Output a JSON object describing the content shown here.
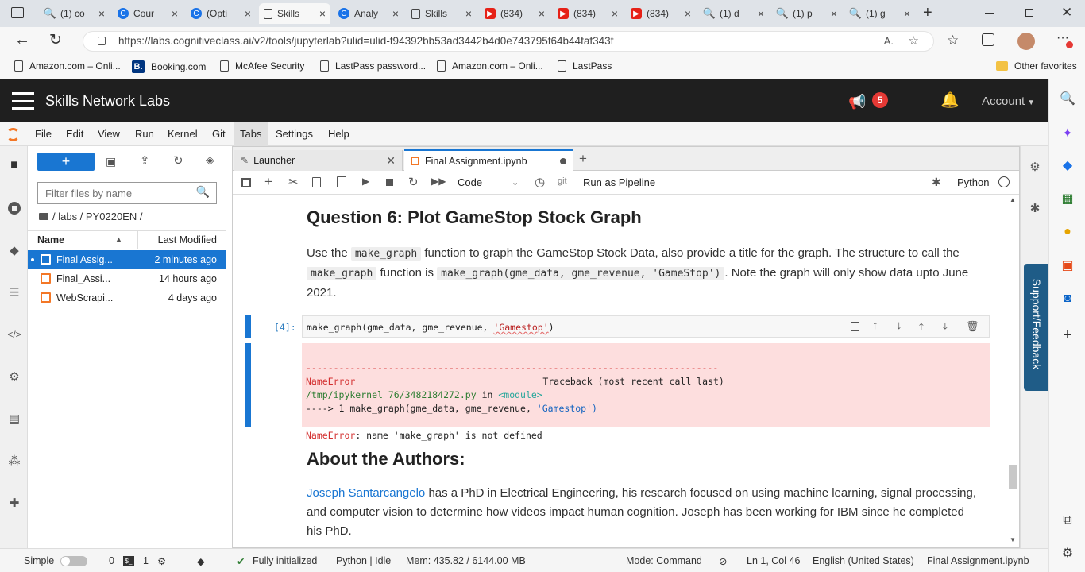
{
  "browser": {
    "tabs": [
      {
        "label": "(1) co",
        "icon": "search-icon"
      },
      {
        "label": "Cour",
        "icon": "coursera-icon"
      },
      {
        "label": "(Opti",
        "icon": "coursera-icon"
      },
      {
        "label": "Skills",
        "icon": "page-icon",
        "active": true
      },
      {
        "label": "Analy",
        "icon": "coursera-icon"
      },
      {
        "label": "Skills",
        "icon": "page-icon"
      },
      {
        "label": "(834)",
        "icon": "youtube-icon"
      },
      {
        "label": "(834)",
        "icon": "youtube-icon"
      },
      {
        "label": "(834)",
        "icon": "youtube-icon"
      },
      {
        "label": "(1) d",
        "icon": "search-icon"
      },
      {
        "label": "(1) p",
        "icon": "search-icon"
      },
      {
        "label": "(1) g",
        "icon": "search-icon"
      }
    ],
    "url": "https://labs.cognitiveclass.ai/v2/tools/jupyterlab?ulid=ulid-f94392bb53ad3442b4d0e743795f64b44faf343f",
    "favorites": [
      "Amazon.com – Onli...",
      "Booking.com",
      "McAfee Security",
      "LastPass password...",
      "Amazon.com – Onli...",
      "LastPass"
    ],
    "other_favorites": "Other favorites"
  },
  "header": {
    "title": "Skills Network Labs",
    "notification_count": "5",
    "account": "Account"
  },
  "menu": [
    "File",
    "Edit",
    "View",
    "Run",
    "Kernel",
    "Git",
    "Tabs",
    "Settings",
    "Help"
  ],
  "filebrowser": {
    "filter_placeholder": "Filter files by name",
    "breadcrumb": "/ labs / PY0220EN /",
    "col_name": "Name",
    "col_modified": "Last Modified",
    "files": [
      {
        "name": "Final Assig...",
        "modified": "2 minutes ago",
        "selected": true
      },
      {
        "name": "Final_Assi...",
        "modified": "14 hours ago"
      },
      {
        "name": "WebScrapi...",
        "modified": "4 days ago"
      }
    ]
  },
  "notebook": {
    "tabs": [
      {
        "label": "Launcher"
      },
      {
        "label": "Final Assignment.ipynb"
      }
    ],
    "cell_type": "Code",
    "git_label": "git",
    "run_pipeline": "Run as Pipeline",
    "kernel": "Python",
    "q6_title": "Question 6: Plot GameStop Stock Graph",
    "q6_p1": "Use the",
    "q6_c1": "make_graph",
    "q6_p2": "function to graph the GameStop Stock Data, also provide a title for the graph. The structure to call the",
    "q6_c2": "make_graph",
    "q6_p3": "function is",
    "q6_c3": "make_graph(gme_data, gme_revenue, 'GameStop')",
    "q6_p4": ". Note the graph will only show data upto June 2021.",
    "prompt": "[4]:",
    "code_fn": "make_graph(gme_data, gme_revenue, ",
    "code_str": "'Gamestop'",
    "code_end": ")",
    "err_dashes": "---------------------------------------------------------------------------",
    "err_name": "NameError",
    "err_tb": "Traceback (most recent call last)",
    "err_file": "/tmp/ipykernel_76/3482184272.py",
    "err_in": " in ",
    "err_module": "<module>",
    "err_arrow": "----> 1 make_graph(gme_data, gme_revenue, ",
    "err_arrow_str": "'Gamestop'",
    "err_arrow_end": ")",
    "err_final_name": "NameError",
    "err_final_msg": ": name 'make_graph' is not defined",
    "about_title": "About the Authors:",
    "author_link": "Joseph Santarcangelo",
    "author_text": " has a PhD in Electrical Engineering, his research focused on using machine learning, signal processing, and computer vision to determine how videos impact human cognition. Joseph has been working for IBM since he completed his PhD."
  },
  "support": "Support/Feedback",
  "statusbar": {
    "mode": "Simple",
    "n0": "0",
    "n1": "1",
    "git_status": "Fully initialized",
    "kernel": "Python | Idle",
    "mem": "Mem: 435.82 / 6144.00 MB",
    "cmd": "Mode: Command",
    "pos": "Ln 1, Col 46",
    "lang": "English (United States)",
    "file": "Final Assignment.ipynb"
  },
  "colors": {
    "accent": "#1976d2",
    "error_bg": "#fddede",
    "header_bg": "#1f1f1f",
    "badge": "#e53935"
  }
}
